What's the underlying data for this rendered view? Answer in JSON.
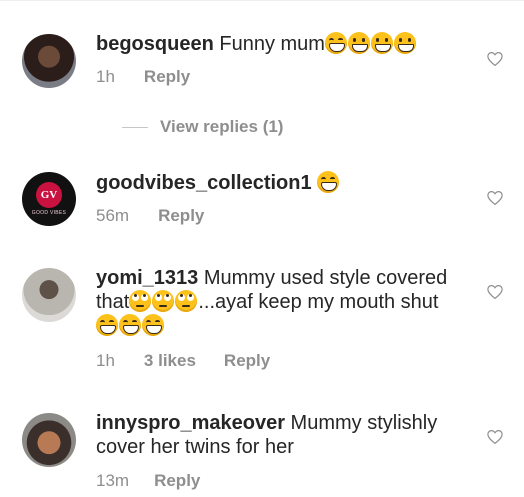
{
  "comments": [
    {
      "username": "begosqueen",
      "text": " Funny mum",
      "emojis": [
        "grinning-squinting-face",
        "beaming-face",
        "beaming-face",
        "beaming-face"
      ],
      "time": "1h",
      "likes": "",
      "reply": "Reply",
      "view_replies": "View replies (1)"
    },
    {
      "username": "goodvibes_collection1",
      "text": " ",
      "emojis": [
        "grinning-squinting-face"
      ],
      "time": "56m",
      "likes": "",
      "reply": "Reply",
      "avatar_badge": "GV",
      "avatar_sub": "GOOD VIBES"
    },
    {
      "username": "yomi_1313",
      "text_line1": " Mummy used style covered",
      "text_line2_a": "that",
      "text_line2_b": "...ayaf keep my mouth shut",
      "emojis_line2": [
        "face-with-rolling-eyes",
        "face-with-rolling-eyes",
        "face-with-rolling-eyes"
      ],
      "emojis_line3": [
        "grinning-squinting-face",
        "grinning-squinting-face",
        "grinning-squinting-face"
      ],
      "time": "1h",
      "likes": "3 likes",
      "reply": "Reply"
    },
    {
      "username": "innyspro_makeover",
      "text_line1": " Mummy stylishly",
      "text_line2": "cover her twins for her",
      "time": "13m",
      "likes": "",
      "reply": "Reply"
    }
  ],
  "icons": {
    "like": "heart-outline-icon"
  },
  "colors": {
    "text": "#262626",
    "secondary": "#8e8e8e",
    "divider": "#c7c7c7"
  }
}
